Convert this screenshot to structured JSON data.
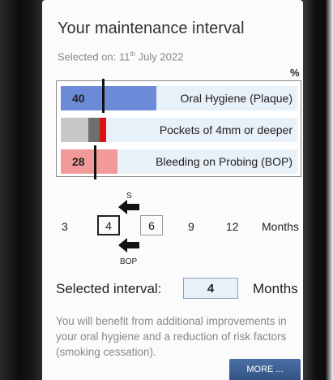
{
  "header": {
    "title": "Your maintenance interval",
    "selected_on_prefix": "Selected on: 11",
    "selected_on_sup": "th",
    "selected_on_suffix": " July 2022"
  },
  "risk_bars": {
    "unit": "%",
    "rows": [
      {
        "label": "Oral Hygiene (Plaque)",
        "value_text": "40",
        "value": 40,
        "color": "#6b8bd8"
      },
      {
        "label": "Pockets of 4mm or deeper",
        "value_text": "",
        "color_gray": "#c8c8c8",
        "color_dark": "#6e6e6e",
        "color_red": "#e01010"
      },
      {
        "label": "Bleeding on Probing (BOP)",
        "value_text": "28",
        "value": 28,
        "color": "#f29a9a"
      }
    ]
  },
  "interval_scale": {
    "s_label": "S",
    "bop_label": "BOP",
    "months": [
      "3",
      "4",
      "6",
      "9",
      "12"
    ],
    "unit_label": "Months"
  },
  "selected_interval": {
    "label": "Selected interval:",
    "value": "4",
    "unit": "Months"
  },
  "description": "You will benefit from additional improvements in your oral hygiene and a reduction of risk factors (smoking cessation).",
  "more_button_label": "MORE ..."
}
